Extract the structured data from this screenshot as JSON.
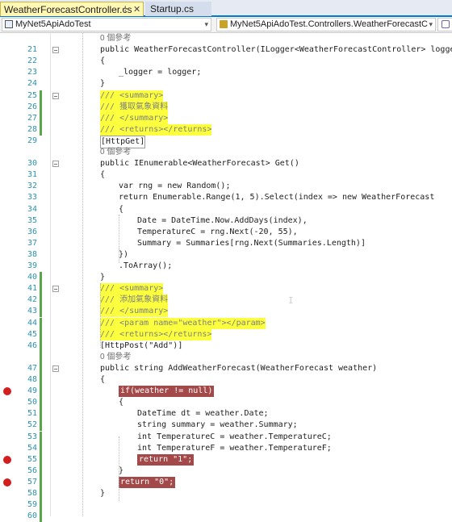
{
  "tabs": {
    "active_label": "WeatherForecastController.cs",
    "pin_glyph": "⊹",
    "close_glyph": "✕",
    "inactive_label": "Startup.cs"
  },
  "nav": {
    "project": "MyNet5ApiAdoTest",
    "class_path": "MyNet5ApiAdoTest.Controllers.WeatherForecastC",
    "chevron": "▾"
  },
  "editor": {
    "lines": [
      {
        "num": "",
        "text": "0 個參考",
        "kind": "ann"
      },
      {
        "num": "21",
        "text": "public WeatherForecastController(ILogger<WeatherForecastController> logger)",
        "kind": "code"
      },
      {
        "num": "22",
        "text": "{",
        "kind": "code"
      },
      {
        "num": "23",
        "text": "_logger = logger;",
        "kind": "code"
      },
      {
        "num": "24",
        "text": "}",
        "kind": "code"
      },
      {
        "num": "25",
        "text": "/// <summary>",
        "kind": "hl"
      },
      {
        "num": "26",
        "text": "/// 獲取氣象資料",
        "kind": "hl"
      },
      {
        "num": "27",
        "text": "/// </summary>",
        "kind": "hl"
      },
      {
        "num": "28",
        "text": "/// <returns></returns>",
        "kind": "hl"
      },
      {
        "num": "29",
        "text": "[HttpGet]",
        "kind": "code"
      },
      {
        "num": "",
        "text": "0 個參考",
        "kind": "ann"
      },
      {
        "num": "30",
        "text": "public IEnumerable<WeatherForecast> Get()",
        "kind": "code"
      },
      {
        "num": "31",
        "text": "{",
        "kind": "code"
      },
      {
        "num": "32",
        "text": "var rng = new Random();",
        "kind": "code"
      },
      {
        "num": "33",
        "text": "return Enumerable.Range(1, 5).Select(index => new WeatherForecast",
        "kind": "code"
      },
      {
        "num": "34",
        "text": "{",
        "kind": "code"
      },
      {
        "num": "35",
        "text": "Date = DateTime.Now.AddDays(index),",
        "kind": "code"
      },
      {
        "num": "36",
        "text": "TemperatureC = rng.Next(-20, 55),",
        "kind": "code"
      },
      {
        "num": "37",
        "text": "Summary = Summaries[rng.Next(Summaries.Length)]",
        "kind": "code"
      },
      {
        "num": "38",
        "text": "})",
        "kind": "code"
      },
      {
        "num": "39",
        "text": ".ToArray();",
        "kind": "code"
      },
      {
        "num": "40",
        "text": "}",
        "kind": "code"
      },
      {
        "num": "41",
        "text": "/// <summary>",
        "kind": "hl"
      },
      {
        "num": "42",
        "text": "/// 添加氣象資料",
        "kind": "hl"
      },
      {
        "num": "43",
        "text": "/// </summary>",
        "kind": "hl"
      },
      {
        "num": "44",
        "text": "/// <param name=\"weather\"></param>",
        "kind": "hl"
      },
      {
        "num": "45",
        "text": "/// <returns></returns>",
        "kind": "hl"
      },
      {
        "num": "46",
        "text": "[HttpPost(\"Add\")]",
        "kind": "code"
      },
      {
        "num": "",
        "text": "0 個參考",
        "kind": "ann"
      },
      {
        "num": "47",
        "text": "public string AddWeatherForecast(WeatherForecast weather)",
        "kind": "code"
      },
      {
        "num": "48",
        "text": "{",
        "kind": "code"
      },
      {
        "num": "49",
        "text": "if(weather != null)",
        "kind": "bp"
      },
      {
        "num": "50",
        "text": "{",
        "kind": "code"
      },
      {
        "num": "51",
        "text": "DateTime dt = weather.Date;",
        "kind": "code"
      },
      {
        "num": "52",
        "text": "string summary = weather.Summary;",
        "kind": "code"
      },
      {
        "num": "53",
        "text": "int TemperatureC = weather.TemperatureC;",
        "kind": "code"
      },
      {
        "num": "54",
        "text": "int TemperatureF = weather.TemperatureF;",
        "kind": "code"
      },
      {
        "num": "55",
        "text": "return \"1\";",
        "kind": "bp"
      },
      {
        "num": "56",
        "text": "}",
        "kind": "code"
      },
      {
        "num": "57",
        "text": "return \"0\";",
        "kind": "bp"
      },
      {
        "num": "58",
        "text": "}",
        "kind": "code"
      },
      {
        "num": "59",
        "text": "",
        "kind": "code"
      },
      {
        "num": "60",
        "text": "",
        "kind": "code"
      }
    ],
    "cursor_marker": "I",
    "colors": {
      "keyword": "#0000ff",
      "type": "#2b91af",
      "string": "#a31515",
      "comment_highlight": "#fbff3d",
      "breakpoint_line": "#a4494a",
      "breakpoint_dot": "#d11f1f",
      "change_green": "#57a64a",
      "change_yellow": "#e8d84b"
    }
  }
}
